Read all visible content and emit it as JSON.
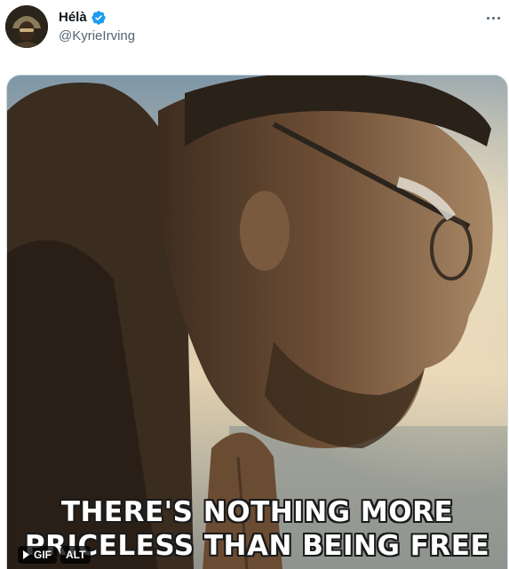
{
  "tweet": {
    "author": {
      "display_name": "Hélà",
      "handle": "@KyrieIrving",
      "verified": true,
      "verified_color": "#1d9bf0"
    },
    "more_icon": "more-horizontal-icon",
    "media": {
      "caption_line1": "THERE'S NOTHING MORE",
      "caption_line2": "PRICELESS THAN BEING FREE",
      "badge_gif": "GIF",
      "badge_alt": "ALT",
      "play_icon": "play-icon"
    }
  },
  "colors": {
    "text_primary": "#0f1419",
    "text_secondary": "#536471",
    "border": "#cfd9de"
  }
}
